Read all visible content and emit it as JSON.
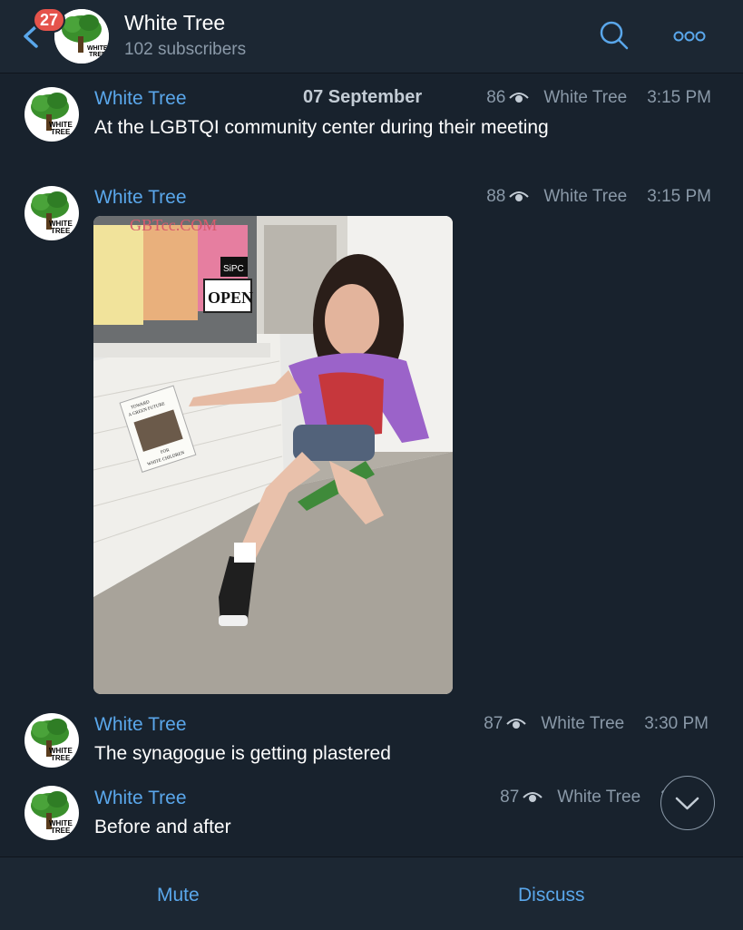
{
  "header": {
    "back_badge": "27",
    "title": "White Tree",
    "subtitle": "102 subscribers",
    "avatar_text_1": "WHITE",
    "avatar_text_2": "TREE"
  },
  "date_separator": "07 September",
  "messages": [
    {
      "sender": "White Tree",
      "text": "At the LGBTQI community center during their meeting",
      "views": "86",
      "author": "White Tree",
      "time": "3:15 PM"
    },
    {
      "sender": "White Tree",
      "text": "",
      "views": "88",
      "author": "White Tree",
      "time": "3:15 PM",
      "photo": {
        "storefront_sign": "GBTcc.COM",
        "door_sign_1": "SiPC",
        "door_sign_2": "OPEN",
        "flyer_text_1": "TOWARD",
        "flyer_text_2": "A GREEN FUTURE",
        "flyer_text_3": "FOR",
        "flyer_text_4": "WHITE CHILDREN"
      }
    },
    {
      "sender": "White Tree",
      "text": "The synagogue is getting plastered",
      "views": "87",
      "author": "White Tree",
      "time": "3:30 PM"
    },
    {
      "sender": "White Tree",
      "text": "Before and after",
      "views": "87",
      "author": "White Tree",
      "time": "3:"
    }
  ],
  "bottom_bar": {
    "mute_label": "Mute",
    "discuss_label": "Discuss"
  },
  "colors": {
    "background": "#18222d",
    "header": "#1c2733",
    "accent": "#5aa7eb",
    "muted_text": "#8a99a8",
    "badge": "#e5534b"
  },
  "icons": [
    "back-arrow-icon",
    "search-icon",
    "more-icon",
    "eye-icon",
    "chevron-down-icon"
  ]
}
